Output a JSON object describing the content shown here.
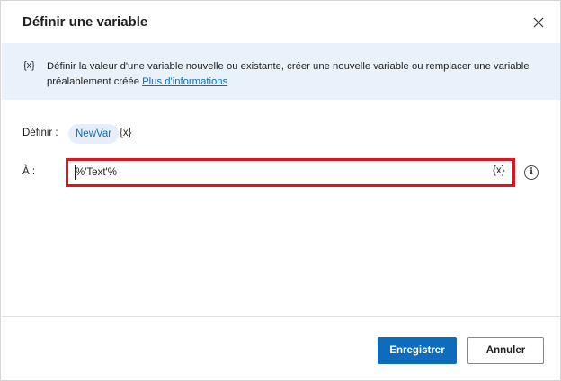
{
  "dialog": {
    "title": "Définir une variable",
    "close_icon": "close-icon"
  },
  "banner": {
    "icon_text": "{x}",
    "description": "Définir la valeur d'une variable nouvelle ou existante, créer une nouvelle variable ou remplacer une variable préalablement créée",
    "link_text": "Plus d'informations"
  },
  "form": {
    "define_label": "Définir :",
    "variable_name": "NewVar",
    "variable_glyph": "{x}",
    "to_label": "À :",
    "value": "%'Text'%",
    "value_glyph": "{x}",
    "info_icon": "info-icon"
  },
  "footer": {
    "save_label": "Enregistrer",
    "cancel_label": "Annuler"
  },
  "colors": {
    "accent": "#0f6cbd",
    "banner_bg": "#e9f1fb",
    "highlight": "#e0131c"
  }
}
